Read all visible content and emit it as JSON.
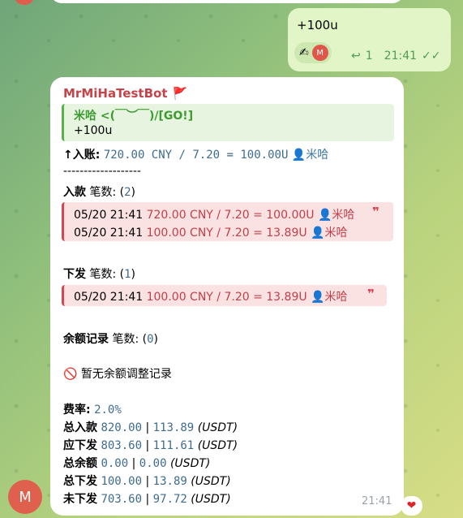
{
  "outgoing": {
    "text": "+100u",
    "reaction_emoji": "✍",
    "avatar_letter": "M",
    "reply_count": "1",
    "time": "21:41"
  },
  "incoming": {
    "sender": "MrMiHaTestBot",
    "sender_flag": "🚩",
    "quote_title": "米哈 <(￣︶￣)/[GO!]",
    "quote_text": "+100u",
    "entry_prefix": "↑入账:",
    "entry_value": "720.00 CNY / 7.20 = 100.00U",
    "entry_user": "👤米哈",
    "divider": "-------------------",
    "income_label": "入款",
    "income_count_label": "笔数: (",
    "income_count": "2",
    "income_close": ")",
    "income_rows": [
      {
        "time": "05/20 21:41",
        "calc": "720.00 CNY / 7.20 = 100.00U",
        "user": "👤米哈"
      },
      {
        "time": "05/20 21:41",
        "calc": "100.00 CNY / 7.20 = 13.89U",
        "user": "👤米哈"
      }
    ],
    "payout_label": "下发",
    "payout_count_label": "笔数: (",
    "payout_count": "1",
    "payout_close": ")",
    "payout_rows": [
      {
        "time": "05/20 21:41",
        "calc": "100.00 CNY / 7.20 = 13.89U",
        "user": "👤米哈"
      }
    ],
    "balance_label": "余额记录",
    "balance_count_label": "笔数: (",
    "balance_count": "0",
    "balance_close": ")",
    "no_balance": "🚫 暂无余额调整记录",
    "fee_label": "费率:",
    "fee_value": "2.0%",
    "totals": [
      {
        "label": "总入款",
        "v1": "820.00",
        "v2": "113.89",
        "unit": "(USDT)"
      },
      {
        "label": "应下发",
        "v1": "803.60",
        "v2": "111.61",
        "unit": "(USDT)"
      },
      {
        "label": "总余额",
        "v1": "0.00",
        "v2": "0.00",
        "unit": "(USDT)"
      },
      {
        "label": "总下发",
        "v1": "100.00",
        "v2": "13.89",
        "unit": "(USDT)"
      },
      {
        "label": "未下发",
        "v1": "703.60",
        "v2": "97.72",
        "unit": "(USDT)"
      }
    ],
    "time": "21:41",
    "reaction": "❤",
    "avatar_letter": "M"
  }
}
